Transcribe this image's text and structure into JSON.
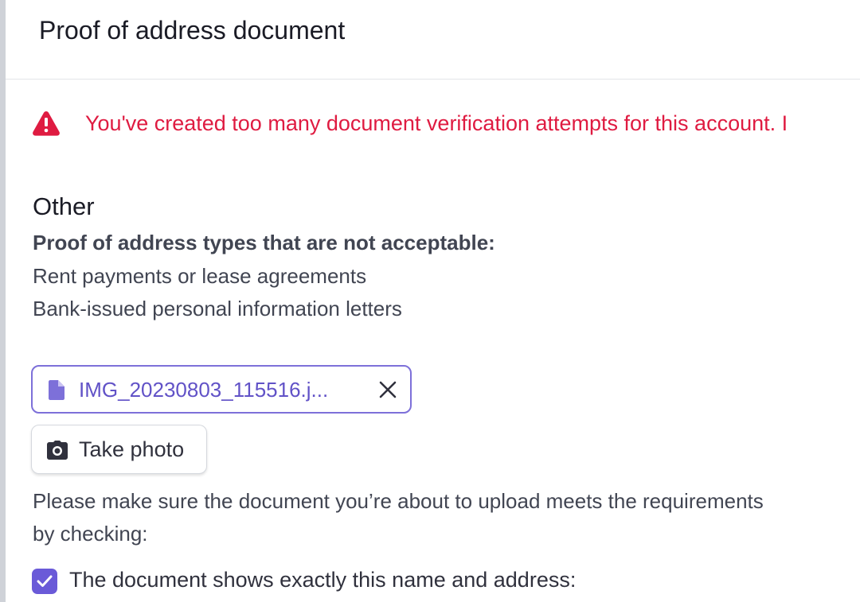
{
  "header": {
    "title": "Proof of address document"
  },
  "alert": {
    "icon": "warning-triangle-icon",
    "color": "#df1b41",
    "message": "You've created too many document verification attempts for this account. I"
  },
  "section": {
    "title": "Other",
    "subheading": "Proof of address types that are not acceptable:",
    "items": [
      "Rent payments or lease agreements",
      "Bank-issued personal information letters"
    ]
  },
  "upload": {
    "file_icon": "file-icon",
    "file_name": "IMG_20230803_115516.j...",
    "remove_icon": "close-icon",
    "accent_color": "#6152c7"
  },
  "take_photo": {
    "icon": "camera-icon",
    "label": "Take photo"
  },
  "instructions": {
    "line1": "Please make sure the document you’re about to upload meets the requirements",
    "line2": "by checking:"
  },
  "confirm": {
    "checked": true,
    "label": "The document shows exactly this name and address:"
  }
}
